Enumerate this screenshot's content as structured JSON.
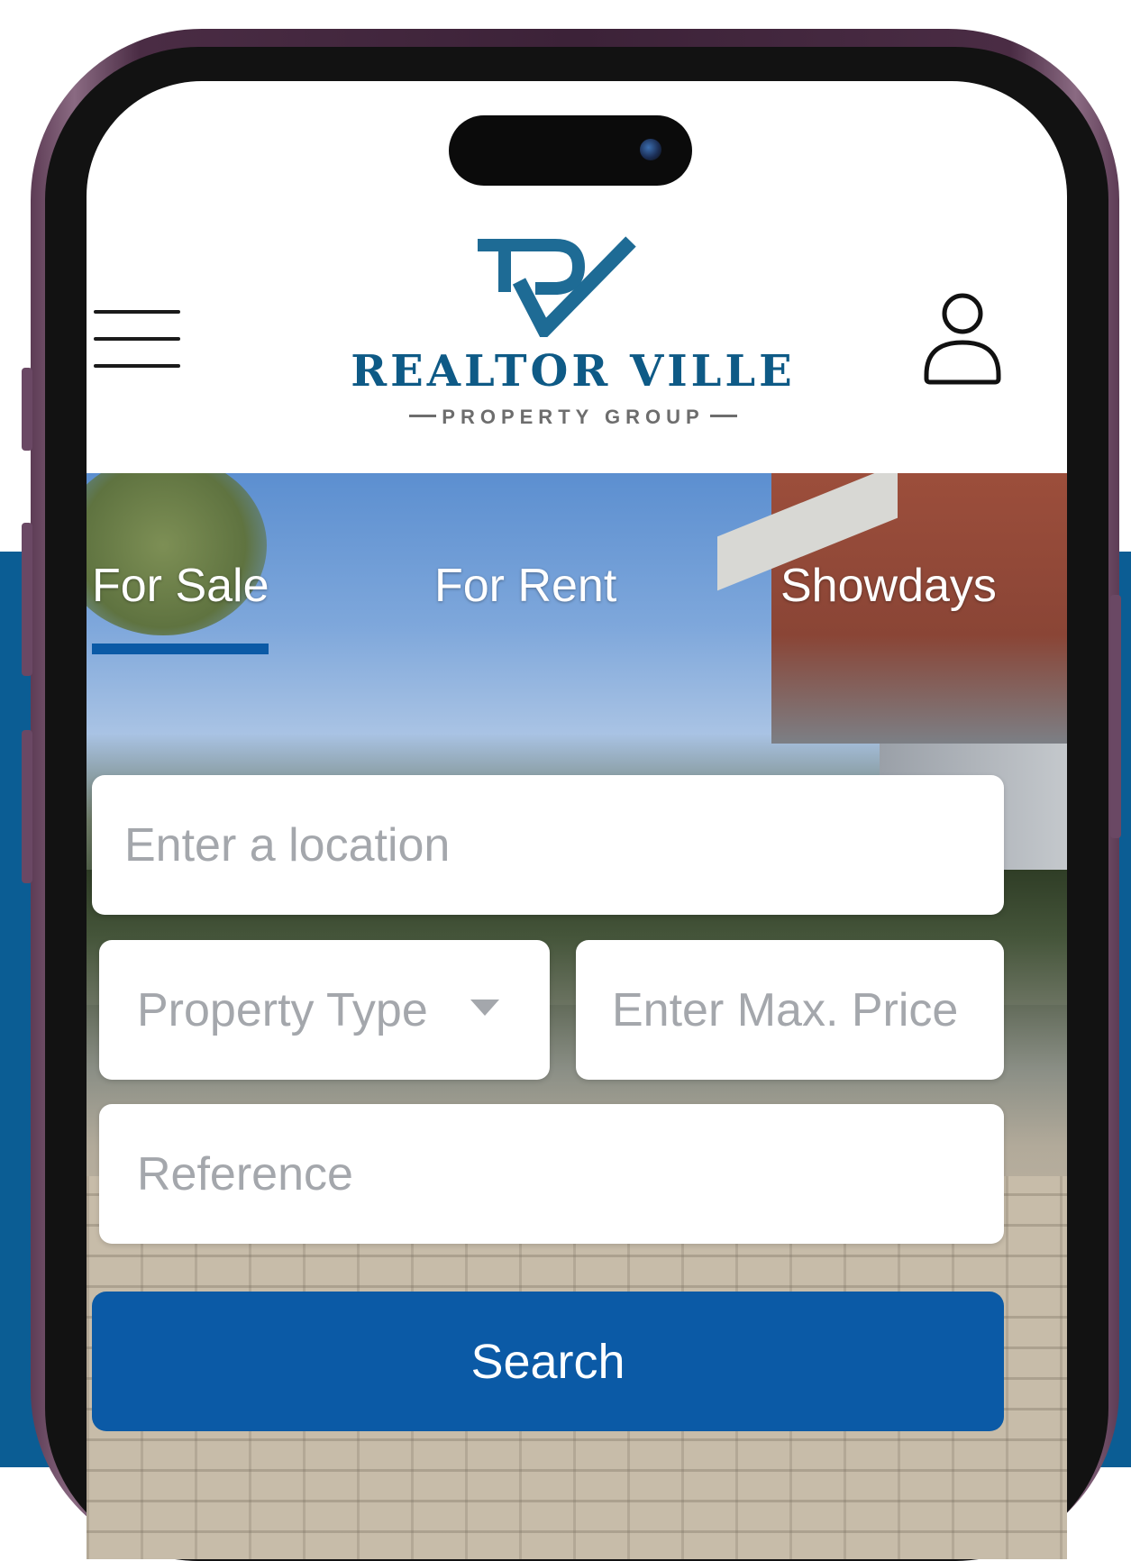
{
  "brand": {
    "name": "REALTOR VILLE",
    "tagline": "PROPERTY GROUP",
    "primary_color": "#0b5aa6",
    "logo_color": "#0e5a86",
    "background_color": "#0b5d94"
  },
  "header": {
    "menu_icon": "hamburger-menu-icon",
    "account_icon": "user-account-icon"
  },
  "tabs": [
    {
      "label": "For Sale",
      "active": true
    },
    {
      "label": "For Rent",
      "active": false
    },
    {
      "label": "Showdays",
      "active": false
    }
  ],
  "search_form": {
    "location_placeholder": "Enter a location",
    "property_type_placeholder": "Property Type",
    "max_price_placeholder": "Enter Max. Price",
    "reference_placeholder": "Reference",
    "search_button_label": "Search"
  }
}
